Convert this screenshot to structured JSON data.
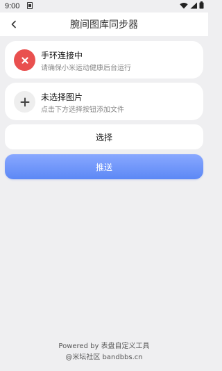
{
  "status_bar": {
    "time": "9:00",
    "app_icon": "notification-app-icon",
    "icons": [
      "wifi-icon",
      "signal-icon",
      "battery-icon"
    ]
  },
  "header": {
    "title": "腕间图库同步器",
    "back_icon": "chevron-left-icon"
  },
  "device_card": {
    "icon": "close-icon",
    "icon_color": "#e9504f",
    "title": "手环连接中",
    "subtitle": "请确保小米运动健康后台运行"
  },
  "image_card": {
    "icon": "plus-icon",
    "title": "未选择图片",
    "subtitle": "点击下方选择按钮添加文件"
  },
  "buttons": {
    "select_label": "选择",
    "push_label": "推送",
    "push_color": "#6f96fb"
  },
  "footer": {
    "line1": "Powered by 表盘自定义工具",
    "line2": "@米坛社区 bandbbs.cn"
  }
}
